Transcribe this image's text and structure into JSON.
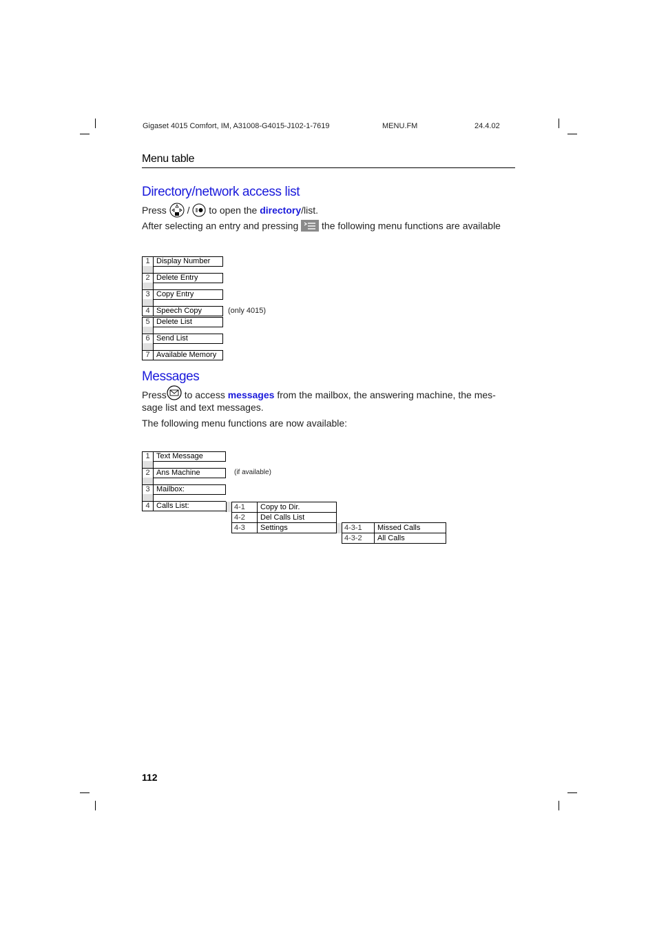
{
  "header": {
    "doc_id": "Gigaset 4015 Comfort, IM, A31008-G4015-J102-1-7619",
    "file": "MENU.FM",
    "date": "24.4.02"
  },
  "section_title": "Menu table",
  "directory": {
    "heading": "Directory/network access list",
    "press_prefix": "Press",
    "slash": "/",
    "press_mid": "to open the",
    "press_link": "directory",
    "press_suffix": "/list.",
    "after_prefix": "After selecting an entry and pressing",
    "after_suffix": "the following menu functions are available",
    "items": [
      {
        "num": "1",
        "label": "Display Number"
      },
      {
        "num": "2",
        "label": "Delete Entry"
      },
      {
        "num": "3",
        "label": "Copy Entry"
      },
      {
        "num": "4",
        "label": "Speech Copy"
      },
      {
        "num": "5",
        "label": "Delete List"
      },
      {
        "num": "6",
        "label": "Send List"
      },
      {
        "num": "7",
        "label": "Available Memory"
      }
    ],
    "note_speech_copy": "(only 4015)"
  },
  "messages": {
    "heading": "Messages",
    "press_prefix": "Press",
    "press_mid": "to access",
    "press_link": "messages",
    "press_suffix": "from the mailbox, the answering machine, the mes-",
    "line2": "sage list and text messages.",
    "line3": "The following menu functions are now available:",
    "items": [
      {
        "num": "1",
        "label": "Text Message"
      },
      {
        "num": "2",
        "label": "Ans Machine"
      },
      {
        "num": "3",
        "label": "Mailbox:"
      },
      {
        "num": "4",
        "label": "Calls List:"
      }
    ],
    "note_ans_machine": "(if available)",
    "calls_list_sub": [
      {
        "code": "4-1",
        "label": "Copy to Dir."
      },
      {
        "code": "4-2",
        "label": "Del Calls List"
      },
      {
        "code": "4-3",
        "label": "Settings"
      }
    ],
    "settings_sub": [
      {
        "code": "4-3-1",
        "label": "Missed Calls"
      },
      {
        "code": "4-3-2",
        "label": "All Calls"
      }
    ]
  },
  "page_number": "112",
  "colors": {
    "heading_blue": "#1a1adb",
    "spacer_gray": "#e0e0e0"
  }
}
